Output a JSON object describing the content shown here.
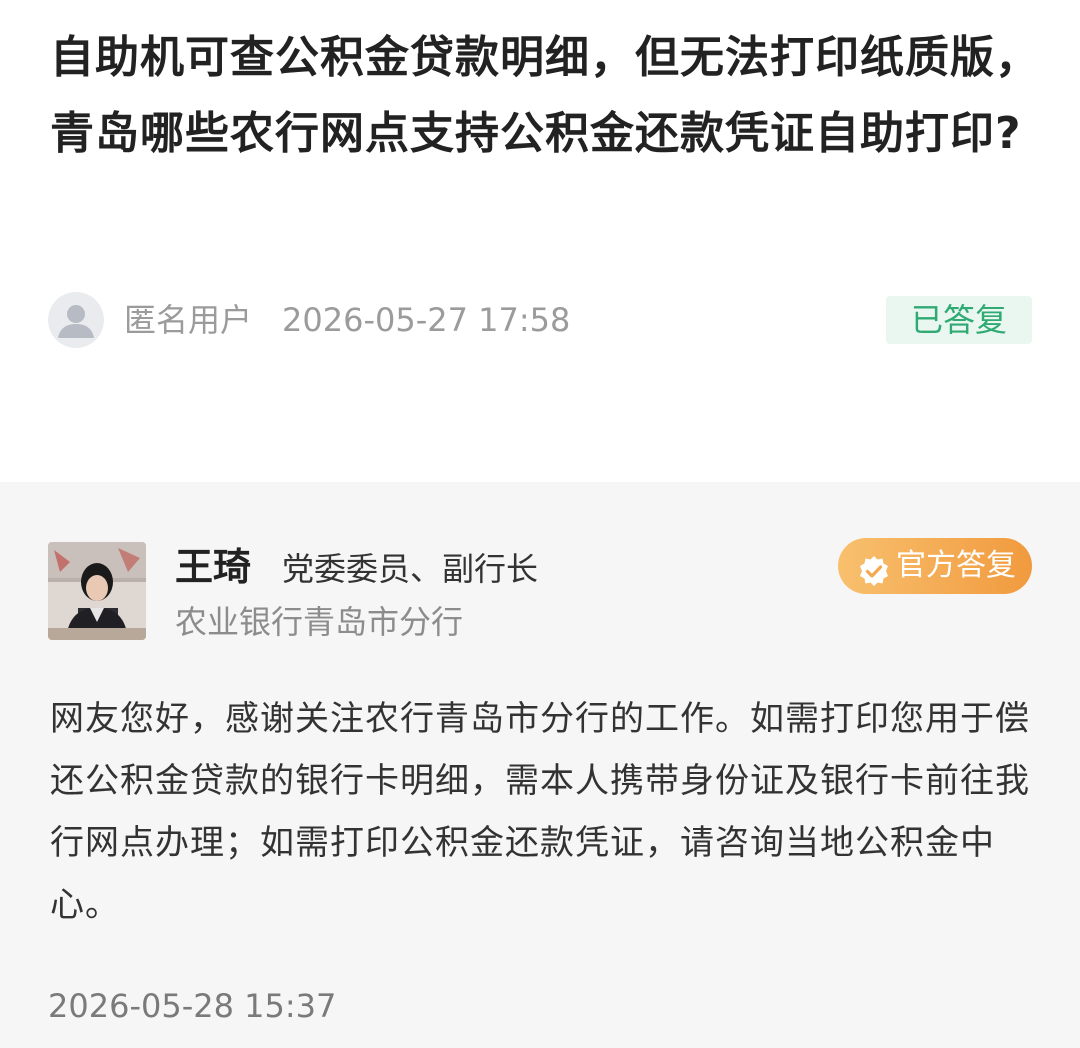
{
  "question": {
    "title": "自助机可查公积金贷款明细，但无法打印纸质版，青岛哪些农行网点支持公积金还款凭证自助打印?",
    "asker_avatar_icon": "user-icon",
    "asker_name": "匿名用户",
    "asked_time": "2026-05-27 17:58",
    "status": "已答复",
    "status_color": "#2faa73"
  },
  "answer": {
    "responder_name": "王琦",
    "responder_role": "党委委员、副行长",
    "responder_org": "农业银行青岛市分行",
    "official_badge_label": "官方答复",
    "official_badge_icon": "check-badge-icon",
    "official_badge_color": "#f19a3e",
    "body": "网友您好，感谢关注农行青岛市分行的工作。如需打印您用于偿还公积金贷款的银行卡明细，需本人携带身份证及银行卡前往我行网点办理；如需打印公积金还款凭证，请咨询当地公积金中心。",
    "answered_time": "2026-05-28 15:37"
  }
}
